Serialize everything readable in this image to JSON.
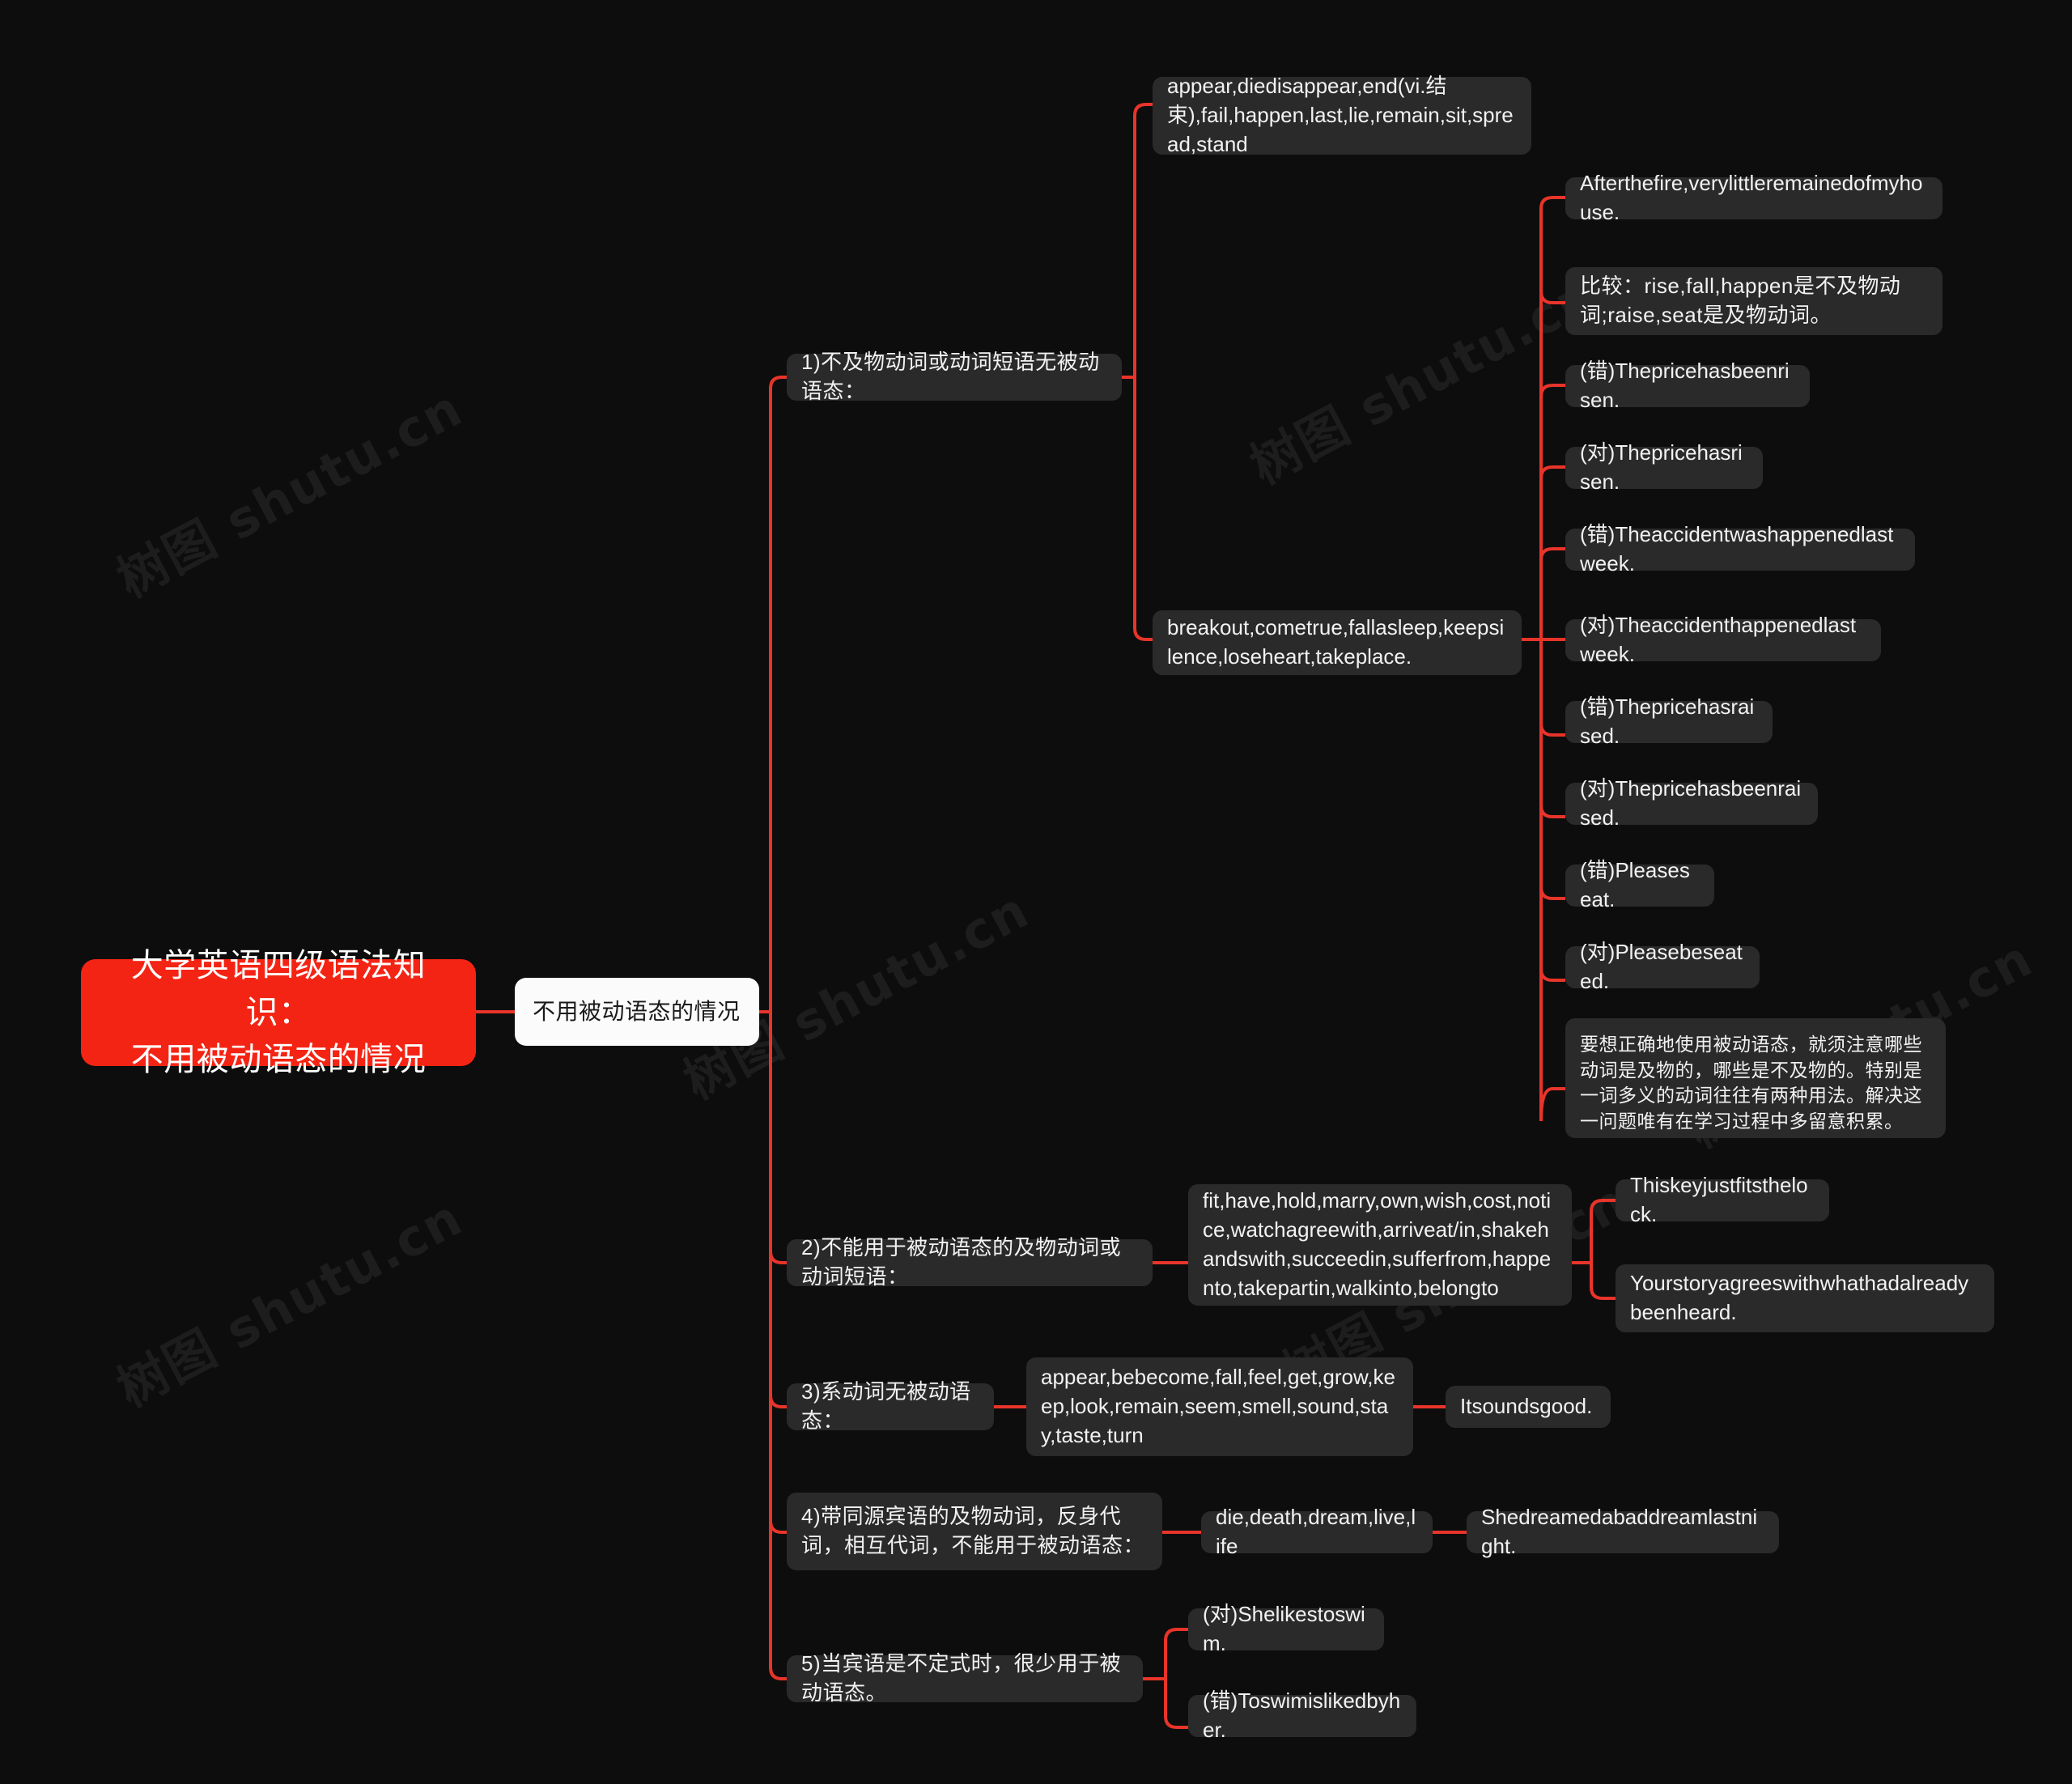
{
  "meta": {
    "background_color": "#0d0d0d",
    "node_color": "#2a2a2a",
    "root_color": "#f42414",
    "link_color": "#e8342a",
    "text_color": "#f2f2f2",
    "watermark_text": "树图 shutu.cn"
  },
  "mindmap": {
    "root": {
      "label": "大学英语四级语法知识：\n不用被动语态的情况"
    },
    "trunk": {
      "label": "不用被动语态的情况"
    },
    "branches": [
      {
        "id": "b1",
        "label": "1)不及物动词或动词短语无被动语态：",
        "children": [
          {
            "id": "b1c1",
            "label": "appear,diedisappear,end(vi.结束),fail,happen,last,lie,remain,sit,spread,stand",
            "children": []
          },
          {
            "id": "b1c2",
            "label": "breakout,cometrue,fallasleep,keepsilence,loseheart,takeplace.",
            "children": [
              {
                "id": "e1",
                "label": "Afterthefire,verylittleremainedofmyhouse."
              },
              {
                "id": "e2",
                "label": "比较：rise,fall,happen是不及物动词;raise,seat是及物动词。"
              },
              {
                "id": "e3",
                "label": "(错)Thepricehasbeenrisen."
              },
              {
                "id": "e4",
                "label": "(对)Thepricehasrisen."
              },
              {
                "id": "e5",
                "label": "(错)Theaccidentwashappenedlastweek."
              },
              {
                "id": "e6",
                "label": "(对)Theaccidenthappenedlastweek."
              },
              {
                "id": "e7",
                "label": "(错)Thepricehasraised."
              },
              {
                "id": "e8",
                "label": "(对)Thepricehasbeenraised."
              },
              {
                "id": "e9",
                "label": "(错)Pleaseseat."
              },
              {
                "id": "e10",
                "label": "(对)Pleasebeseated."
              },
              {
                "id": "e11",
                "label": "要想正确地使用被动语态，就须注意哪些动词是及物的，哪些是不及物的。特别是一词多义的动词往往有两种用法。解决这一问题唯有在学习过程中多留意积累。"
              }
            ]
          }
        ]
      },
      {
        "id": "b2",
        "label": "2)不能用于被动语态的及物动词或动词短语：",
        "children": [
          {
            "id": "b2c1",
            "label": "fit,have,hold,marry,own,wish,cost,notice,watchagreewith,arriveat/in,shakehandswith,succeedin,sufferfrom,happento,takepartin,walkinto,belongto",
            "children": [
              {
                "id": "b2e1",
                "label": "Thiskeyjustfitsthelock."
              },
              {
                "id": "b2e2",
                "label": "Yourstoryagreeswithwhathadalreadybeenheard."
              }
            ]
          }
        ]
      },
      {
        "id": "b3",
        "label": "3)系动词无被动语态：",
        "children": [
          {
            "id": "b3c1",
            "label": "appear,bebecome,fall,feel,get,grow,keep,look,remain,seem,smell,sound,stay,taste,turn",
            "children": [
              {
                "id": "b3e1",
                "label": "Itsoundsgood."
              }
            ]
          }
        ]
      },
      {
        "id": "b4",
        "label": "4)带同源宾语的及物动词，反身代词，相互代词，不能用于被动语态：",
        "children": [
          {
            "id": "b4c1",
            "label": "die,death,dream,live,life",
            "children": [
              {
                "id": "b4e1",
                "label": "Shedreamedabaddreamlastnight."
              }
            ]
          }
        ]
      },
      {
        "id": "b5",
        "label": "5)当宾语是不定式时，很少用于被动语态。",
        "children": [
          {
            "id": "b5c1",
            "label": "(对)Shelikestoswim.",
            "children": []
          },
          {
            "id": "b5c2",
            "label": "(错)Toswimislikedbyher.",
            "children": []
          }
        ]
      }
    ]
  },
  "watermarks": [
    {
      "text": "树图 shutu.cn"
    },
    {
      "text": "树图 shutu.cn"
    },
    {
      "text": "树图 shutu.cn"
    },
    {
      "text": "树图 shutu.cn"
    },
    {
      "text": "树图 shutu.cn"
    },
    {
      "text": "树图 shutu.cn"
    }
  ]
}
